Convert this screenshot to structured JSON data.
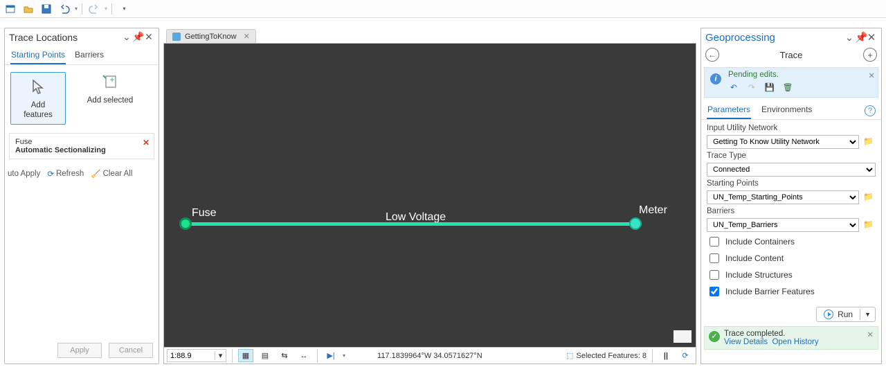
{
  "leftPane": {
    "title": "Trace Locations",
    "tabs": {
      "starting": "Starting Points",
      "barriers": "Barriers"
    },
    "addFeatures1": "Add",
    "addFeatures2": "features",
    "addSelected": "Add selected",
    "item": {
      "title": "Fuse",
      "subtitle": "Automatic Sectionalizing"
    },
    "autoApply": "uto Apply",
    "refresh": "Refresh",
    "clearAll": "Clear All",
    "applyBtn": "Apply",
    "cancelBtn": "Cancel"
  },
  "map": {
    "tabName": "GettingToKnow",
    "fuse": "Fuse",
    "lowVoltage": "Low Voltage",
    "meter": "Meter"
  },
  "status": {
    "scale": "1:88.9",
    "coords": "117.1839964°W 34.0571627°N",
    "selFeatures": "Selected Features: 8"
  },
  "gp": {
    "title": "Geoprocessing",
    "toolName": "Trace",
    "pending": "Pending edits.",
    "tabParams": "Parameters",
    "tabEnv": "Environments",
    "p_inputNet": "Input Utility Network",
    "v_inputNet": "Getting To Know Utility Network",
    "p_traceType": "Trace Type",
    "v_traceType": "Connected",
    "p_start": "Starting Points",
    "v_start": "UN_Temp_Starting_Points",
    "p_barriers": "Barriers",
    "v_barriers": "UN_Temp_Barriers",
    "cb_containers": "Include Containers",
    "cb_content": "Include Content",
    "cb_structures": "Include Structures",
    "cb_barrierFeat": "Include Barrier Features",
    "runLabel": "Run",
    "statusMsg": "Trace completed.",
    "viewDetails": "View Details",
    "openHistory": "Open History"
  }
}
